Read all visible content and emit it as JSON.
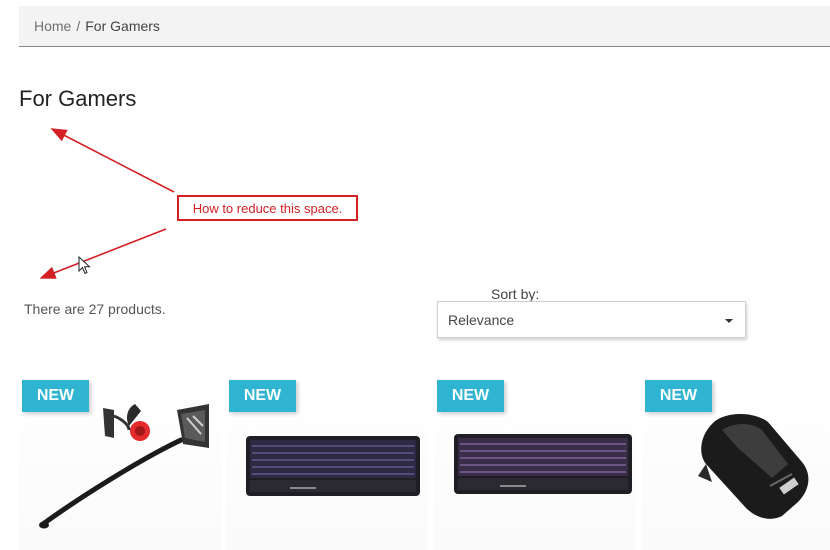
{
  "breadcrumb": {
    "items": [
      {
        "label": "Home"
      },
      {
        "label": "For Gamers"
      }
    ],
    "separator": "/"
  },
  "page_title": "For Gamers",
  "annotation": {
    "text": "How to reduce this space.",
    "color": "#d32025"
  },
  "product_count_text": "There are 27 products.",
  "sort": {
    "label": "Sort by:",
    "selected": "Relevance"
  },
  "products": [
    {
      "badge": "NEW",
      "image": "gaming-headset-image"
    },
    {
      "badge": "NEW",
      "image": "gaming-keyboard-image"
    },
    {
      "badge": "NEW",
      "image": "gaming-keyboard-image"
    },
    {
      "badge": "NEW",
      "image": "gaming-mouse-image"
    }
  ],
  "colors": {
    "accent": "#2fb5d2",
    "breadcrumb_bg": "#f3f3f3"
  }
}
